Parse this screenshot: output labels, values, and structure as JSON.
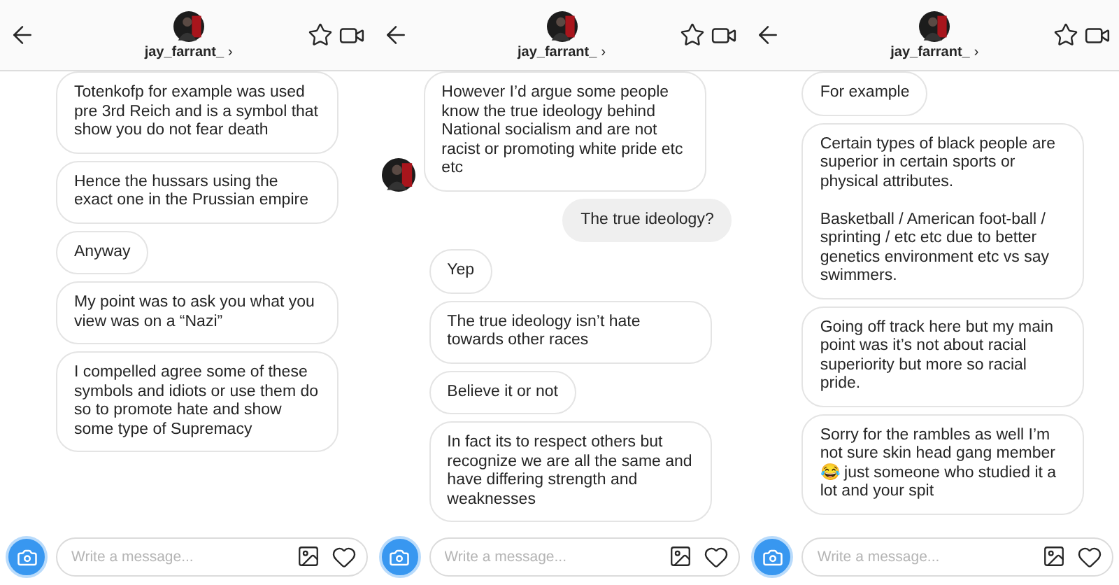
{
  "panels": [
    {
      "header": {
        "username": "jay_farrant_",
        "chevron": "›"
      },
      "messages": [
        {
          "kind": "received",
          "avatar": false,
          "text": "Totenkofp for example was used pre 3rd Reich and is a symbol that show you do not fear death"
        },
        {
          "kind": "received",
          "avatar": false,
          "text": "Hence the hussars using the exact one in the Prussian empire"
        },
        {
          "kind": "received",
          "avatar": false,
          "text": "Anyway"
        },
        {
          "kind": "received",
          "avatar": false,
          "text": "My point was to ask you what you view was on a “Nazi”"
        },
        {
          "kind": "received",
          "avatar": false,
          "text": "I compelled agree some of these symbols and idiots or use them do so to promote hate and show some type of Supremacy"
        }
      ],
      "composer": {
        "placeholder": "Write a message..."
      }
    },
    {
      "header": {
        "username": "jay_farrant_",
        "chevron": "›"
      },
      "messages": [
        {
          "kind": "received",
          "avatar": true,
          "text": "However I’d argue some people know the true ideology behind National socialism and are not racist or promoting white pride etc etc"
        },
        {
          "kind": "sent",
          "avatar": false,
          "text": "The true ideology?"
        },
        {
          "kind": "received",
          "avatar": false,
          "text": "Yep"
        },
        {
          "kind": "received",
          "avatar": false,
          "text": "The true ideology isn’t hate towards other races"
        },
        {
          "kind": "received",
          "avatar": false,
          "text": "Believe it or not"
        },
        {
          "kind": "received",
          "avatar": false,
          "text": "In fact its to respect others but recognize we are all the same and have differing strength and weaknesses"
        }
      ],
      "composer": {
        "placeholder": "Write a message..."
      }
    },
    {
      "header": {
        "username": "jay_farrant_",
        "chevron": "›"
      },
      "messages": [
        {
          "kind": "received",
          "avatar": false,
          "text": "For example"
        },
        {
          "kind": "received",
          "avatar": false,
          "text": "Certain types of black people are superior in certain sports or physical attributes.\n\nBasketball / American foot-ball / sprinting / etc etc due to better genetics environment etc vs say swimmers."
        },
        {
          "kind": "received",
          "avatar": false,
          "text": "Going off track here but my main point was it’s not about racial superiority but more so racial pride."
        },
        {
          "kind": "received",
          "avatar": false,
          "text": "Sorry for the rambles as well I’m not sure skin head gang member 😂 just someone who studied it a lot and your spit"
        }
      ],
      "composer": {
        "placeholder": "Write a message..."
      }
    }
  ]
}
